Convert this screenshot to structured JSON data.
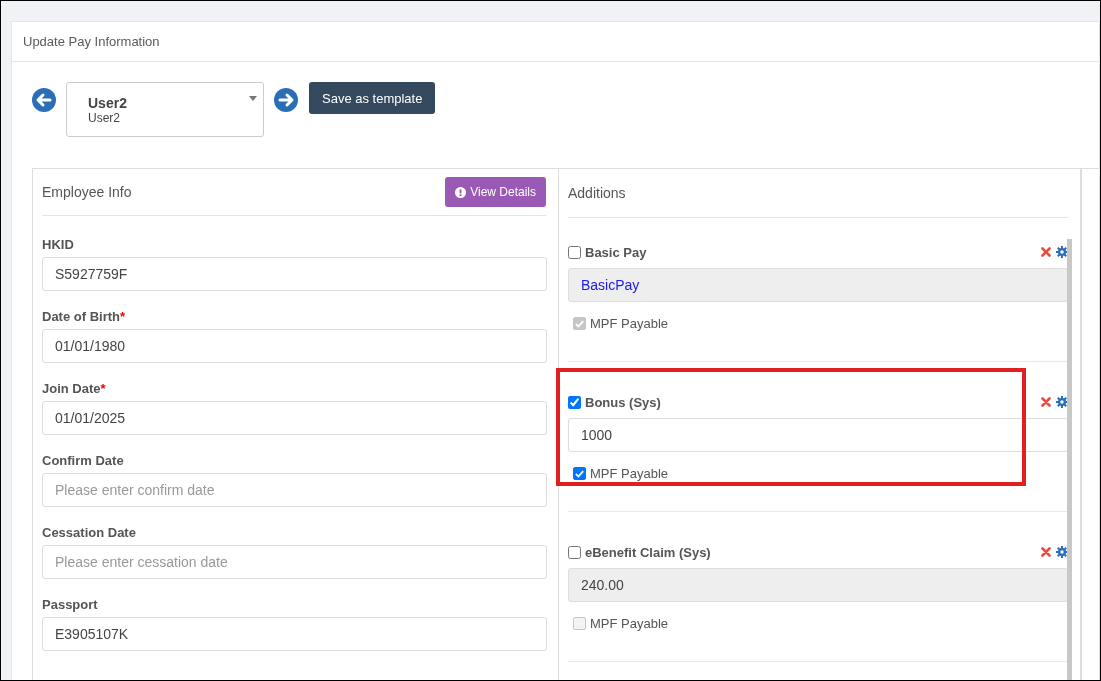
{
  "page": {
    "title": "Update Pay Information"
  },
  "navigator": {
    "employee_name": "User2",
    "employee_code": "User2",
    "save_button": "Save as template"
  },
  "employee_info": {
    "title": "Employee Info",
    "view_button": "View Details",
    "fields": [
      {
        "label": "HKID",
        "value": "S5927759F"
      },
      {
        "label": "Date of Birth",
        "required_mark": "*",
        "value": "01/01/1980"
      },
      {
        "label": "Join Date",
        "required_mark": "*",
        "value": "01/01/2025"
      },
      {
        "label": "Confirm Date",
        "placeholder": "Please enter confirm date"
      },
      {
        "label": "Cessation Date",
        "placeholder": "Please enter cessation date"
      },
      {
        "label": "Passport",
        "value": "E3905107K"
      }
    ]
  },
  "additions": {
    "title": "Additions",
    "items": [
      {
        "name": "Basic Pay",
        "checked": false,
        "value": "BasicPay",
        "kind": "formula",
        "readonly": true,
        "mpf_label": "MPF Payable",
        "mpf_checked": true,
        "mpf_disabled": true,
        "highlighted": false
      },
      {
        "name": "Bonus (Sys)",
        "checked": true,
        "value": "1000",
        "kind": "amount",
        "readonly": false,
        "mpf_label": "MPF Payable",
        "mpf_checked": true,
        "mpf_disabled": false,
        "highlighted": true
      },
      {
        "name": "eBenefit Claim (Sys)",
        "checked": false,
        "value": "240.00",
        "kind": "amount",
        "readonly": true,
        "mpf_label": "MPF Payable",
        "mpf_checked": false,
        "mpf_disabled": true,
        "highlighted": false
      }
    ]
  }
}
